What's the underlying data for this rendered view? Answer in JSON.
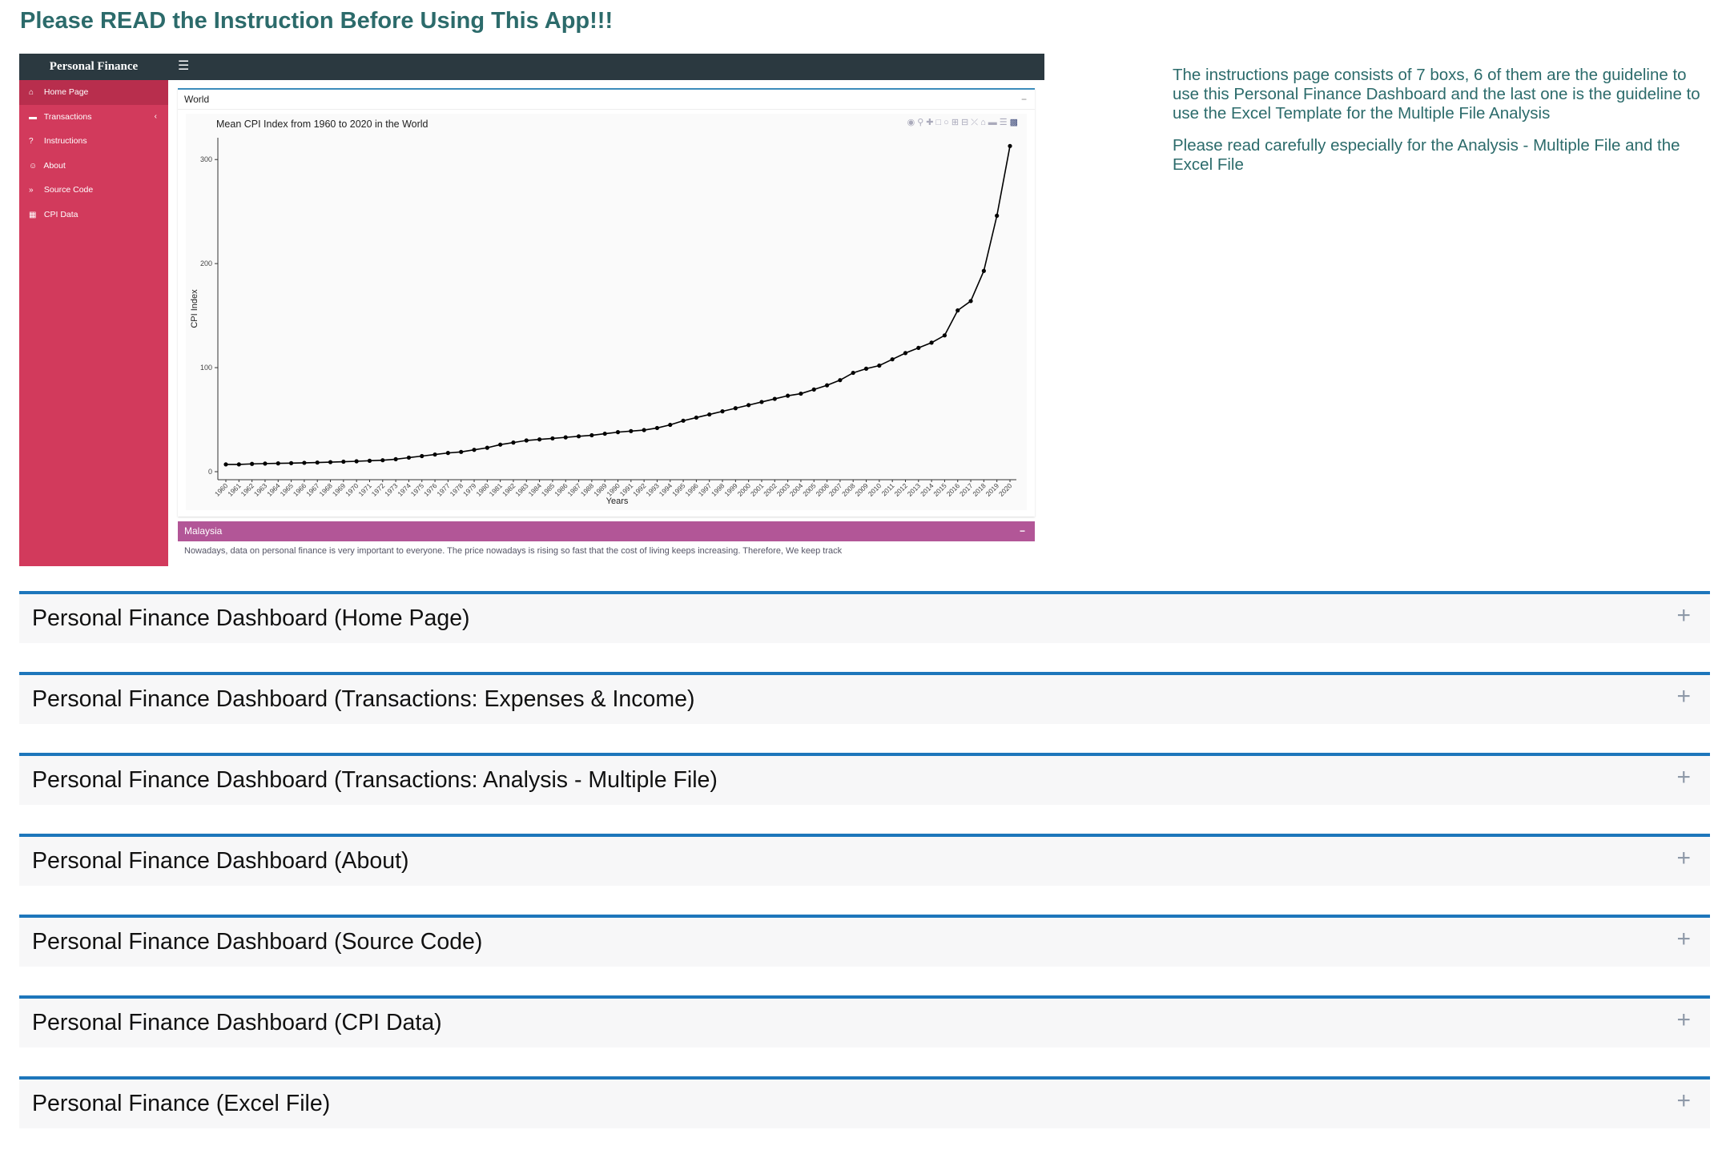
{
  "page": {
    "title": "Please READ the Instruction Before Using This App!!!"
  },
  "screenshot": {
    "brand": "Personal Finance",
    "menu_icon": "hamburger-icon",
    "sidebar": [
      {
        "label": "Home Page",
        "icon": "home-icon",
        "glyph": "⌂"
      },
      {
        "label": "Transactions",
        "icon": "credit-card-icon",
        "glyph": "▬",
        "caret": "‹"
      },
      {
        "label": "Instructions",
        "icon": "question-icon",
        "glyph": "?"
      },
      {
        "label": "About",
        "icon": "users-icon",
        "glyph": "☺"
      },
      {
        "label": "Source Code",
        "icon": "double-chevron-icon",
        "glyph": "»"
      },
      {
        "label": "CPI Data",
        "icon": "table-icon",
        "glyph": "▦"
      }
    ],
    "world_box": {
      "title": "World",
      "minimize": "−"
    },
    "malaysia_box": {
      "title": "Malaysia",
      "minimize": "−",
      "text": "Nowadays, data on personal finance is very important to everyone. The price nowadays is rising so fast that the cost of living keeps increasing. Therefore, We keep track"
    },
    "modebar_icons": [
      "camera-icon",
      "zoom-icon",
      "pan-icon",
      "box-select-icon",
      "lasso-icon",
      "zoom-in-icon",
      "zoom-out-icon",
      "autoscale-icon",
      "reset-axes-icon",
      "spike-lines-icon",
      "compare-icon",
      "plotly-logo-icon"
    ]
  },
  "chart_data": {
    "type": "line",
    "title": "Mean CPI Index from 1960 to 2020 in the World",
    "xlabel": "Years",
    "ylabel": "CPI Index",
    "ylim": [
      0,
      330
    ],
    "yticks": [
      0,
      100,
      200,
      300
    ],
    "grid": false,
    "x": [
      "1960",
      "1961",
      "1962",
      "1963",
      "1964",
      "1965",
      "1966",
      "1967",
      "1968",
      "1969",
      "1970",
      "1971",
      "1972",
      "1973",
      "1974",
      "1975",
      "1976",
      "1977",
      "1978",
      "1979",
      "1980",
      "1981",
      "1982",
      "1983",
      "1984",
      "1985",
      "1986",
      "1987",
      "1988",
      "1989",
      "1990",
      "1991",
      "1992",
      "1993",
      "1994",
      "1995",
      "1996",
      "1997",
      "1998",
      "1999",
      "2000",
      "2001",
      "2002",
      "2003",
      "2004",
      "2005",
      "2006",
      "2007",
      "2008",
      "2009",
      "2010",
      "2011",
      "2012",
      "2013",
      "2014",
      "2015",
      "2016",
      "2017",
      "2018",
      "2019",
      "2020"
    ],
    "values": [
      7,
      7,
      7.5,
      7.8,
      8,
      8.2,
      8.5,
      8.8,
      9.2,
      9.6,
      10,
      10.5,
      11,
      12,
      13.5,
      15,
      16.5,
      18,
      19,
      21,
      23,
      26,
      28,
      30,
      31,
      32,
      33,
      34,
      35,
      36.5,
      38,
      39,
      40,
      42,
      45,
      49,
      52,
      55,
      58,
      61,
      64,
      67,
      70,
      73,
      75,
      79,
      83,
      88,
      95,
      99,
      102,
      108,
      114,
      119,
      124,
      131,
      155,
      164,
      193,
      246,
      313
    ]
  },
  "description": {
    "p1": "The instructions page consists of 7 boxs, 6 of them are the guideline to use this Personal Finance Dashboard and the last one is the guideline to use the Excel Template for the Multiple File Analysis",
    "p2": "Please read carefully especially for the Analysis - Multiple File and the Excel File"
  },
  "accordion": {
    "expand_icon": "+",
    "items": [
      {
        "title": "Personal Finance Dashboard (Home Page)"
      },
      {
        "title": "Personal Finance Dashboard (Transactions: Expenses & Income)"
      },
      {
        "title": "Personal Finance Dashboard (Transactions: Analysis - Multiple File)"
      },
      {
        "title": "Personal Finance Dashboard (About)"
      },
      {
        "title": "Personal Finance Dashboard (Source Code)"
      },
      {
        "title": "Personal Finance Dashboard (CPI Data)"
      },
      {
        "title": "Personal Finance (Excel File)"
      }
    ]
  },
  "colors": {
    "title": "#2c6b6b",
    "sidebar": "#d23a5c",
    "topbar": "#2b3940",
    "accent": "#1d76bb",
    "malaysia_header": "#b25697"
  }
}
